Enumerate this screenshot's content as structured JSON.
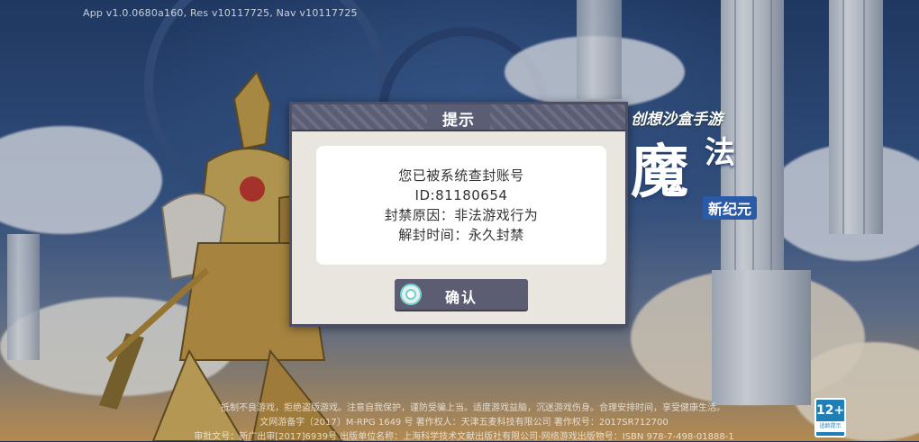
{
  "version_text": "App v1.0.0680a160, Res v10117725, Nav v10117725",
  "logo": {
    "tagline": "创想沙盒手游",
    "big_char": "魔",
    "fa_char": "法",
    "subtitle": "新纪元"
  },
  "dialog": {
    "title": "提示",
    "message_lines": [
      "您已被系统查封账号",
      "ID:81180654",
      "封禁原因：非法游戏行为",
      "解封时间：永久封禁"
    ],
    "confirm_label": "确认"
  },
  "footer": {
    "line1": "抵制不良游戏，拒绝盗版游戏。注意自我保护，谨防受骗上当。适度游戏益脑，沉迷游戏伤身。合理安排时间，享受健康生活。",
    "line2": "文网游备字〔2017〕M-RPG 1649 号  著作权人：天津五麦科技有限公司  著作权号：2017SR712700",
    "line3": "审批文号：新广出审[2017]6939号 出版单位名称：上海科学技术文献出版社有限公司-网络游戏出版物号：ISBN 978-7-498-01888-1"
  },
  "age_rating": {
    "number": "12+",
    "label": "适龄提示"
  },
  "colors": {
    "dialog_header": "#5b5d74",
    "dialog_bg": "#e9e6df",
    "button_bg": "#5c5c72",
    "icon_ring": "#6fd3c6"
  }
}
